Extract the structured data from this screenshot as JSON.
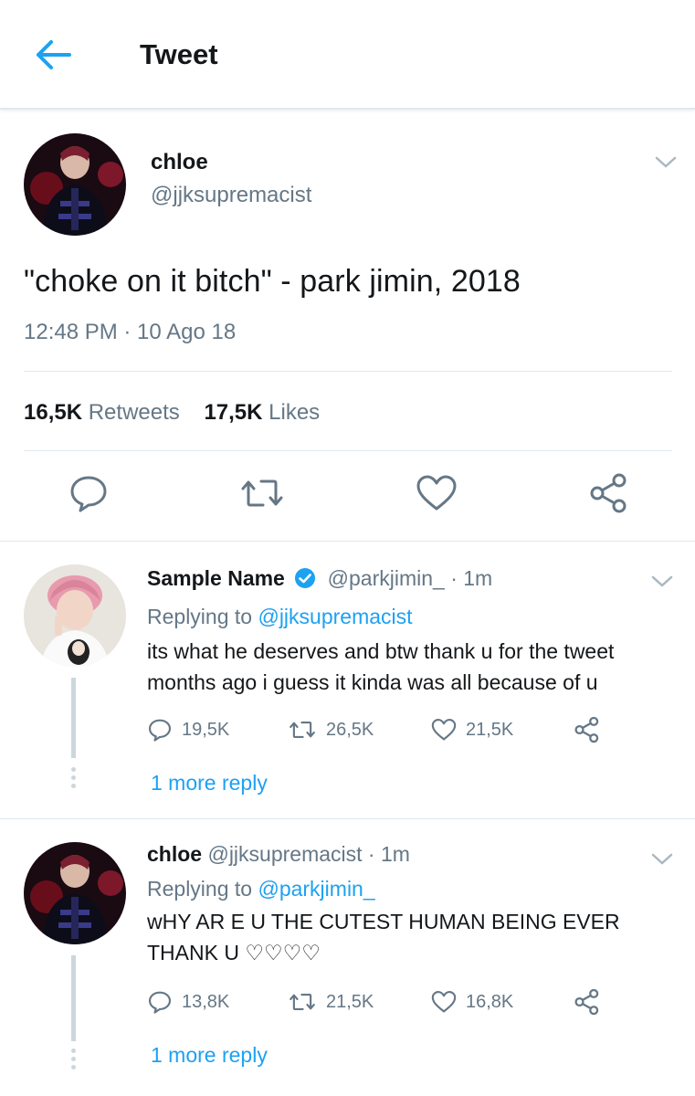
{
  "header": {
    "back_icon": "arrow-left-icon",
    "title": "Tweet",
    "accent_color": "#1da1f2"
  },
  "main_tweet": {
    "name": "chloe",
    "handle": "@jjksupremacist",
    "text": "\"choke on it bitch\" - park jimin, 2018",
    "timestamp": "12:48 PM · 10 Ago 18",
    "retweets_count": "16,5K",
    "retweets_label": "Retweets",
    "likes_count": "17,5K",
    "likes_label": "Likes",
    "actions": [
      "reply-icon",
      "retweet-icon",
      "like-icon",
      "share-icon"
    ]
  },
  "replies": [
    {
      "name": "Sample Name",
      "verified": true,
      "handle": "@parkjimin_",
      "time": "· 1m",
      "replying_prefix": "Replying to",
      "replying_to": "@jjksupremacist",
      "text_line1": "its what he deserves and btw thank u for the tweet",
      "text_line2": "months ago i guess it kinda was all because of u",
      "reply_count": "19,5K",
      "retweet_count": "26,5K",
      "like_count": "21,5K",
      "more_reply": "1 more reply"
    },
    {
      "name": "chloe",
      "verified": false,
      "handle": "@jjksupremacist",
      "time": "· 1m",
      "replying_prefix": "Replying to",
      "replying_to": "@parkjimin_",
      "text_line1": "wHY AR E U THE CUTEST HUMAN BEING EVER",
      "text_line2": "THANK U ♡♡♡♡",
      "reply_count": "13,8K",
      "retweet_count": "21,5K",
      "like_count": "16,8K",
      "more_reply": "1 more reply"
    }
  ]
}
